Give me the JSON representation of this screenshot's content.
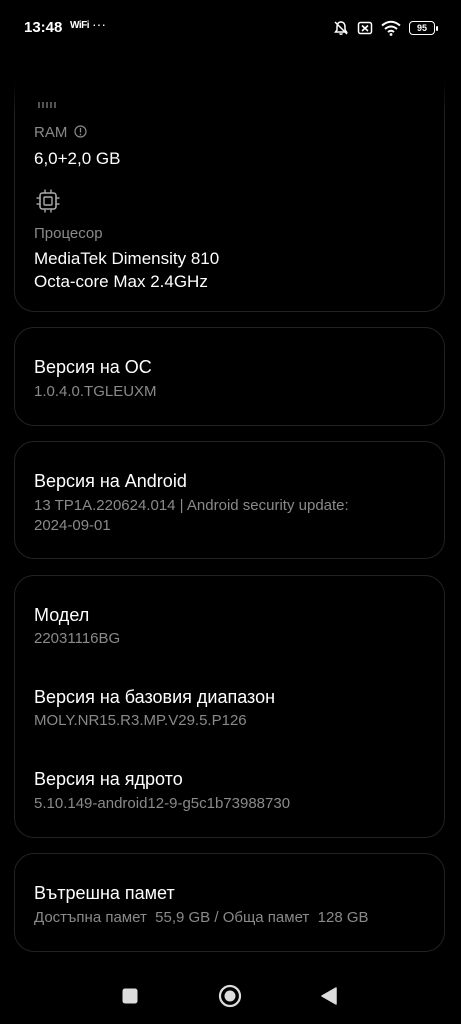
{
  "status_bar": {
    "time": "13:48",
    "extra": "WiFi",
    "dots": "···",
    "battery": "95"
  },
  "specs": {
    "ram_label": "RAM",
    "ram_value": "6,0+2,0 GB",
    "cpu_label": "Процесор",
    "cpu_value_line1": "MediaTek Dimensity 810",
    "cpu_value_line2": "Octa-core Max 2.4GHz"
  },
  "os_version": {
    "title": "Версия на ОС",
    "value": "1.0.4.0.TGLEUXM"
  },
  "android_version": {
    "title": "Версия на Android",
    "value_line1": "13 TP1A.220624.014 | Android security update:",
    "value_line2": "2024-09-01"
  },
  "device_info": {
    "model_title": "Модел",
    "model_value": "22031116BG",
    "baseband_title": "Версия на базовия диапазон",
    "baseband_value": "MOLY.NR15.R3.MP.V29.5.P126",
    "kernel_title": "Версия на ядрото",
    "kernel_value": "5.10.149-android12-9-g5c1b73988730"
  },
  "storage": {
    "title": "Вътрешна памет",
    "value": "Достъпна памет  55,9 GB / Обща памет  128 GB"
  },
  "icons": {
    "back": "arrow-left",
    "ram_info": "info-circle",
    "cpu": "chip",
    "nav_recents": "square",
    "nav_home": "circle",
    "nav_back": "triangle-left"
  }
}
